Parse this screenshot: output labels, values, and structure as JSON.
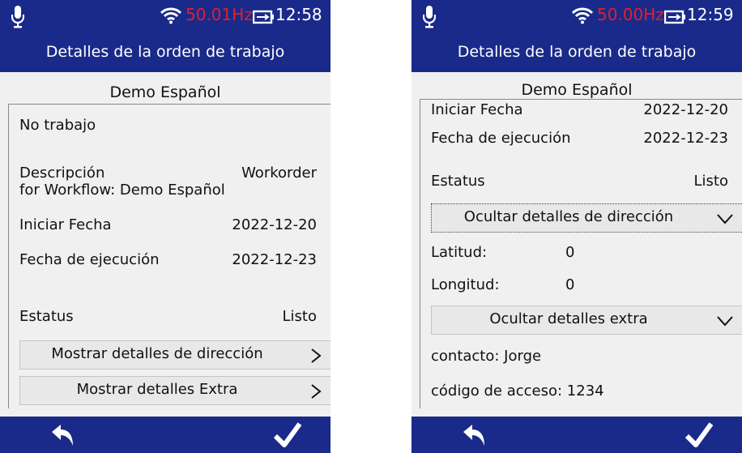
{
  "screens": [
    {
      "status": {
        "frequency": "50.01Hz",
        "time": "12:58"
      },
      "title": "Detalles de la orden de trabajo",
      "heading": "Demo Español",
      "no_trabajo_label": "No trabajo",
      "description_label": "Descripción",
      "description_value": "Workorder",
      "description_cont": "for Workflow: Demo Español",
      "start_label": "Iniciar Fecha",
      "start_value": "2022-12-20",
      "exec_label": "Fecha de ejecución",
      "exec_value": "2022-12-23",
      "status_label": "Estatus",
      "status_value": "Listo",
      "address_button": "Mostrar detalles de dirección",
      "extra_button": "Mostrar detalles Extra"
    },
    {
      "status": {
        "frequency": "50.00Hz",
        "time": "12:59"
      },
      "title": "Detalles de la orden de trabajo",
      "heading": "Demo Español",
      "start_label": "Iniciar Fecha",
      "start_value": "2022-12-20",
      "exec_label": "Fecha de ejecución",
      "exec_value": "2022-12-23",
      "status_label": "Estatus",
      "status_value": "Listo",
      "address_button": "Ocultar detalles de dirección",
      "lat_label": "Latitud:",
      "lat_value": "0",
      "lon_label": "Longitud:",
      "lon_value": "0",
      "extra_button": "Ocultar detalles extra",
      "contact": "contacto: Jorge",
      "access_code": "código de acceso: 1234"
    }
  ],
  "icons": {
    "mic": "microphone-icon",
    "wifi": "wifi-icon",
    "battery": "battery-charging-icon",
    "expand": "chevron-right-icon",
    "collapse": "chevron-down-icon",
    "back": "back-arrow-icon",
    "confirm": "checkmark-icon"
  },
  "colors": {
    "bar": "#1a2a8a",
    "frequency": "#e0202a",
    "background": "#f0f0f0"
  }
}
